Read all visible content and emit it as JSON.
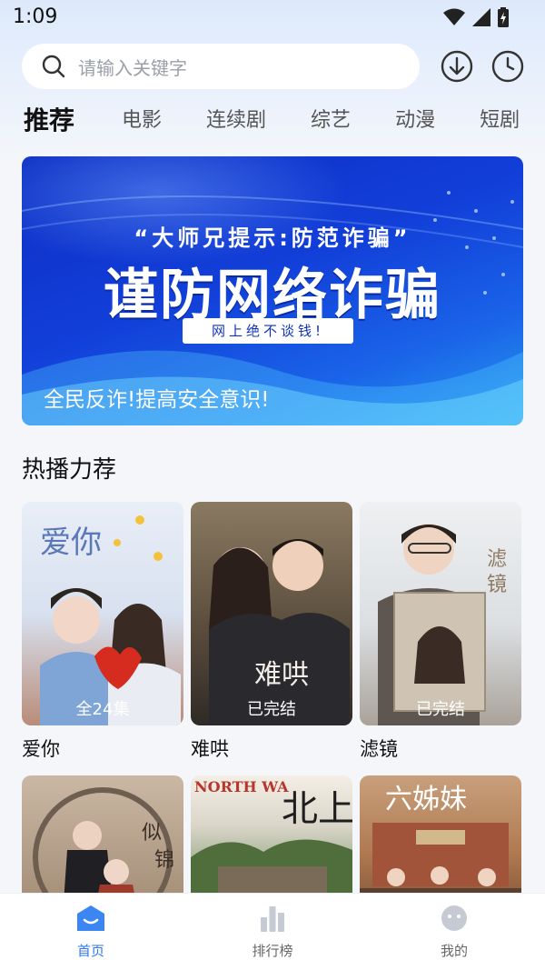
{
  "status_bar": {
    "time": "1:09"
  },
  "search": {
    "placeholder": "请输入关键字"
  },
  "header_icons": [
    "download-icon",
    "history-clock-icon"
  ],
  "tabs": [
    {
      "label": "推荐",
      "active": true
    },
    {
      "label": "电影"
    },
    {
      "label": "连续剧"
    },
    {
      "label": "综艺"
    },
    {
      "label": "动漫"
    },
    {
      "label": "短剧"
    }
  ],
  "banner": {
    "quote": "“大师兄提示:防范诈骗”",
    "headline": "谨防网络诈骗",
    "chip": "网上绝不谈钱!",
    "slogan": "全民反诈!提高安全意识!"
  },
  "section": {
    "title": "热播力荐"
  },
  "posters": [
    {
      "title": "爱你",
      "badge": "全24集",
      "art_text": "爱你"
    },
    {
      "title": "难哄",
      "badge": "已完结",
      "art_text": "难哄"
    },
    {
      "title": "滤镜",
      "badge": "已完结",
      "art_text": "滤镜"
    }
  ],
  "posters_row2": [
    {
      "art_text": "似锦"
    },
    {
      "art_text": "北上",
      "caption": "NORTH WA"
    },
    {
      "art_text": "六姊妹"
    }
  ],
  "bottom_nav": [
    {
      "label": "首页",
      "active": true
    },
    {
      "label": "排行榜"
    },
    {
      "label": "我的"
    }
  ],
  "colors": {
    "accent": "#2f77f0",
    "banner_blue": "#123fd9"
  }
}
